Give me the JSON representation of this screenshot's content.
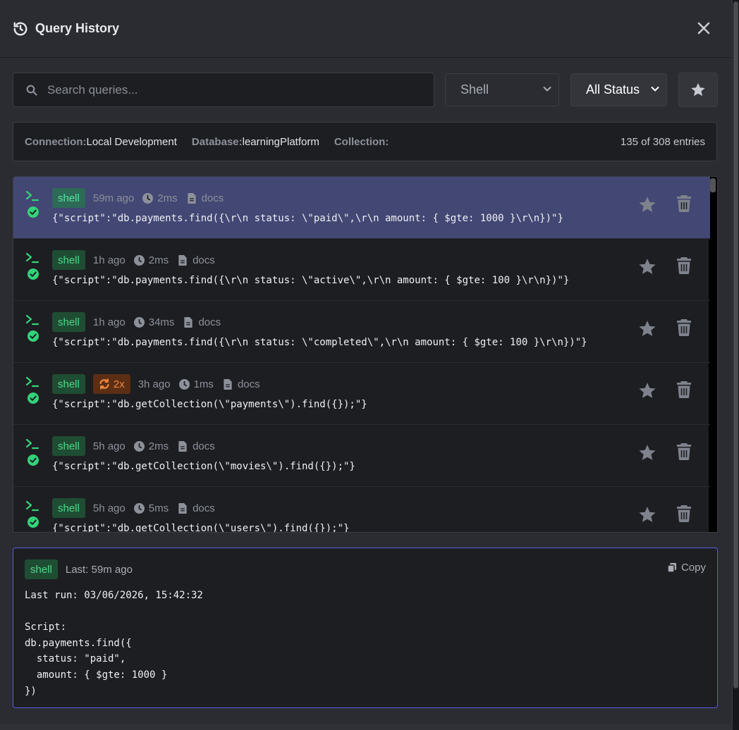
{
  "header": {
    "title": "Query History"
  },
  "filters": {
    "search_placeholder": "Search queries...",
    "type_select": "Shell",
    "status_select": "All Status"
  },
  "context": {
    "connection_label": "Connection:",
    "connection_value": "Local Development",
    "database_label": "Database:",
    "database_value": "learningPlatform",
    "collection_label": "Collection:",
    "collection_value": "",
    "entries": "135 of 308 entries"
  },
  "entries": [
    {
      "type": "shell",
      "ago": "59m ago",
      "duration": "2ms",
      "result": "docs",
      "repeat": "",
      "query": "{\"script\":\"db.payments.find({\\r\\n status: \\\"paid\\\",\\r\\n amount: { $gte: 1000 }\\r\\n})\"}"
    },
    {
      "type": "shell",
      "ago": "1h ago",
      "duration": "2ms",
      "result": "docs",
      "repeat": "",
      "query": "{\"script\":\"db.payments.find({\\r\\n status: \\\"active\\\",\\r\\n amount: { $gte: 100 }\\r\\n})\"}"
    },
    {
      "type": "shell",
      "ago": "1h ago",
      "duration": "34ms",
      "result": "docs",
      "repeat": "",
      "query": "{\"script\":\"db.payments.find({\\r\\n status: \\\"completed\\\",\\r\\n amount: { $gte: 100 }\\r\\n})\"}"
    },
    {
      "type": "shell",
      "ago": "3h ago",
      "duration": "1ms",
      "result": "docs",
      "repeat": "2x",
      "query": "{\"script\":\"db.getCollection(\\\"payments\\\").find({});\"}"
    },
    {
      "type": "shell",
      "ago": "5h ago",
      "duration": "2ms",
      "result": "docs",
      "repeat": "",
      "query": "{\"script\":\"db.getCollection(\\\"movies\\\").find({});\"}"
    },
    {
      "type": "shell",
      "ago": "5h ago",
      "duration": "5ms",
      "result": "docs",
      "repeat": "",
      "query": "{\"script\":\"db.getCollection(\\\"users\\\").find({});\"}"
    }
  ],
  "preview": {
    "type": "shell",
    "last": "Last: 59m ago",
    "copy_label": "Copy",
    "body": "Last run: 03/06/2026, 15:42:32\n\nScript:\ndb.payments.find({\n  status: \"paid\",\n  amount: { $gte: 1000 }\n})"
  },
  "colors": {
    "selected_row": "#434774",
    "shell_badge": "#4dd88a",
    "repeat_badge": "#f08a3c",
    "preview_border": "#5a5fd6"
  }
}
